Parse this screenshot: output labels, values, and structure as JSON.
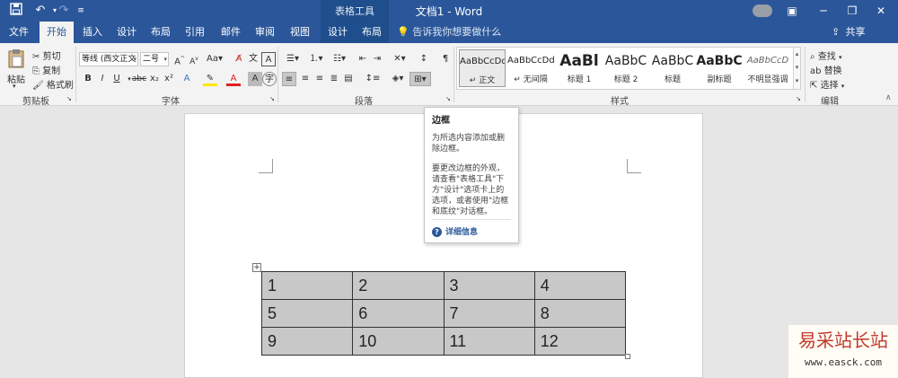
{
  "title_bar": {
    "save_icon": "save-icon",
    "undo_icon": "undo-icon",
    "redo_icon": "redo-icon",
    "customize_icon": "customize-qat-icon",
    "context_group": "表格工具",
    "doc_title": "文档1 - Word",
    "window_buttons": [
      "ribbon-display-icon",
      "minimize-icon",
      "maximize-icon",
      "close-icon"
    ]
  },
  "tabs": [
    {
      "label": "文件"
    },
    {
      "label": "开始"
    },
    {
      "label": "插入"
    },
    {
      "label": "设计"
    },
    {
      "label": "布局"
    },
    {
      "label": "引用"
    },
    {
      "label": "邮件"
    },
    {
      "label": "审阅"
    },
    {
      "label": "视图"
    },
    {
      "label": "设计"
    },
    {
      "label": "布局"
    }
  ],
  "tell_me": "告诉我你想要做什么",
  "share": "共享",
  "clipboard": {
    "paste": "粘贴",
    "cut": "剪切",
    "copy": "复制",
    "format_painter": "格式刷",
    "group": "剪贴板"
  },
  "font": {
    "font_name": "等线 (西文正文",
    "font_size": "二号",
    "group": "字体",
    "buttons": [
      "B",
      "I",
      "U",
      "abc",
      "x₂",
      "x²"
    ]
  },
  "paragraph": {
    "group": "段落"
  },
  "styles": {
    "group": "样式",
    "items": [
      {
        "sample": "AaBbCcDd",
        "name": "↵ 正文"
      },
      {
        "sample": "AaBbCcDd",
        "name": "↵ 无间隔"
      },
      {
        "sample": "AaBl",
        "name": "标题 1"
      },
      {
        "sample": "AaBbC",
        "name": "标题 2"
      },
      {
        "sample": "AaBbC",
        "name": "标题"
      },
      {
        "sample": "AaBbC",
        "name": "副标题"
      },
      {
        "sample": "AaBbCcD",
        "name": "不明显强调"
      }
    ]
  },
  "editing": {
    "find": "查找",
    "replace": "替换",
    "select": "选择",
    "group": "编辑"
  },
  "tooltip": {
    "title": "边框",
    "text1": "为所选内容添加或删除边框。",
    "text2": "要更改边框的外观，请查看\"表格工具\"下方\"设计\"选项卡上的选项，或者使用\"边框和底纹\"对话框。",
    "more": "详细信息"
  },
  "table": {
    "rows": [
      [
        "1",
        "2",
        "3",
        "4"
      ],
      [
        "5",
        "6",
        "7",
        "8"
      ],
      [
        "9",
        "10",
        "11",
        "12"
      ]
    ]
  },
  "watermark": {
    "text": "易采站长站",
    "url": "www.easck.com"
  }
}
